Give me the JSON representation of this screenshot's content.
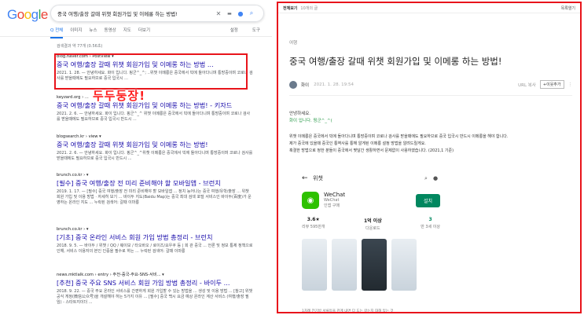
{
  "google": {
    "logo": [
      "G",
      "o",
      "o",
      "g",
      "l",
      "e"
    ],
    "query": "중국 여행/출장 갈때 위챗 회원가입 및 이메롱 하는 방법!",
    "icons": {
      "clear": "close-icon",
      "keyboard": "keyboard-icon",
      "mic": "mic-icon",
      "search": "search-icon"
    },
    "tabs": [
      "Q 전체",
      "이미지",
      "뉴스",
      "동영상",
      "지도",
      "더보기"
    ],
    "tools": [
      "설정",
      "도구"
    ],
    "stats": "검색결과 약 77개 (0.56초)",
    "overlay": "두두둥장!",
    "results": [
      {
        "url": "blog.naver.com › PostView ▾",
        "title": "중국 여행/출장 갈때 위챗 회원가입 및 이메롱 하는 방법 ...",
        "snippet": "2021. 1. 28. — 안녕하세요. 화이 입니다. 핑군^_^; ..위챗 이메롱은 중국에서 빅에 돌아다니며 통방중이며 코로나 검사를 받을때에도 필요하므로 중국 입국시 ..."
      },
      {
        "url": "keyzard.org › ...",
        "title": "중국 여행/출장 갈때 위챗 회원가입 및 이메롱 하는 방법! - 키자드",
        "snippet": "2021. 2. 6. — 안녕하세요. 화이 입니다. 핑군^_^ 위챗 이메롱은 중국에서 빅에 돌아다니며 통방중이며 코로나 검사를 받을때에도 필요하므로 중국 입국시 반드시 ..."
      },
      {
        "url": "blogsearch.kr › view ▾",
        "title": "중국 여행/출장 갈때 위챗 회원가입 및 이메롱 하는 방법!",
        "snippet": "2021. 2. 6. — 안녕하세요. 화이 입니다. 핑군^_^위챗 이메롱은 중국에서 빅에 돌아다니며 통방중이며 코로나 검사를 받을때에도 필요하므로 중국 입국시 반드시 ..."
      },
      {
        "url": "brunch.co.kr › ▾",
        "title": "[필수] 중국 여행/출장 전 미리 준비해야 할 모바일앱 - 브런치",
        "snippet": "2019. 1. 17. — [필수] 중국 여행/출장 전 미리 준비해야 할 모바일앱 ... 정치 능어나는 중국 여행/유학/출장 ... 위챗 회원 가입 및 이용 방법 · 자세히 보기 ... 바이두 지도(Baidu Map)는 중국 최대 검색 포털 서비스인 바이두(百度)가 운영하는 온라인 지도 ... 누락된 검색어: 갈때 이마롱"
      },
      {
        "url": "brunch.co.kr › ▾",
        "title": "[기초] 중국 온라인 서비스 회원 가입 방법 총정리 - 브런치",
        "snippet": "2018. 9. 5. — 바이두 / 위챗 / QQ / 웨이보 / 타오바오 / 로이즈/요우쿠 등 | 회 관 중국 ... 언론 및 정보 통제 정책으로 인해, 서비스 이용자의 본인 인증을 필수로 하는 ... 누락된 검색어: 갈때 이마롱"
      },
      {
        "url": "news.mktlalk.com › entry › 주전-중국-주요-SNS-서비...  ▾",
        "title": "[추천] 중국 주요 SNS 서비스 회원 가입 방법 총정리 - 바이두 ...",
        "snippet": "2018. 9. 22. — 중국 주요 온라인 서비스를 간편하게 회원 가입할 수 있는 방법을 ... 생성 및 이용 방법 ... [참고] 위챗 공식 게정(微信公众号)을 개설해야 하는 5가지 이유 ... [필수] 중국 백시 요금 예상 온라인 계산 서비스 (여행/출장 필임) - 스타트지이더 ..."
      }
    ]
  },
  "blog": {
    "topbar_label": "전체보기",
    "topbar_count": "10개의 글",
    "topbar_list": "목록열기",
    "category": "여행",
    "title": "중국 여행/출장 갈때 위챗 회원가입 및 이메롱 하는 방법!",
    "author": "화이",
    "date": "2021. 1. 28. 19:54",
    "url_copy": "URL 복사",
    "neighbor": "+이웃추가",
    "more": "⋮",
    "greeting": "안녕하세요.",
    "greeting2": "화이 입니다. 핑군^_^(",
    "body": [
      "위챗 이메롱은 중국에서 빅에 돌아다니며 통방중이며 코로나 검사를 받을때에도 필요하므로 중국 입국시 반드시 이메롱을 해야 합니다.",
      "제가 중국에 있을때 중국인 통역사를 통해 알게된 이메롱 설정 방법을 알려드릴게요.",
      "혹결한 방법으로 정한 분들이 중국에서 몇달간 생활하면서 문제없이 사용하였습니다. (2021,1 기준)"
    ],
    "store": {
      "search_title": "위챗",
      "app_name": "WeChat",
      "developer": "WeChat",
      "category": "인앱 구매",
      "install": "설치",
      "rating": "3.6★",
      "rating_label": "리뷰 595만개",
      "downloads": "1억 이상",
      "downloads_label": "다운로드",
      "age": "3",
      "age_label": "만 3세 이상",
      "caption": "1차례 전기방 서류등을 관계 내면 다 도는 갈는지 대해 있는 것"
    }
  }
}
